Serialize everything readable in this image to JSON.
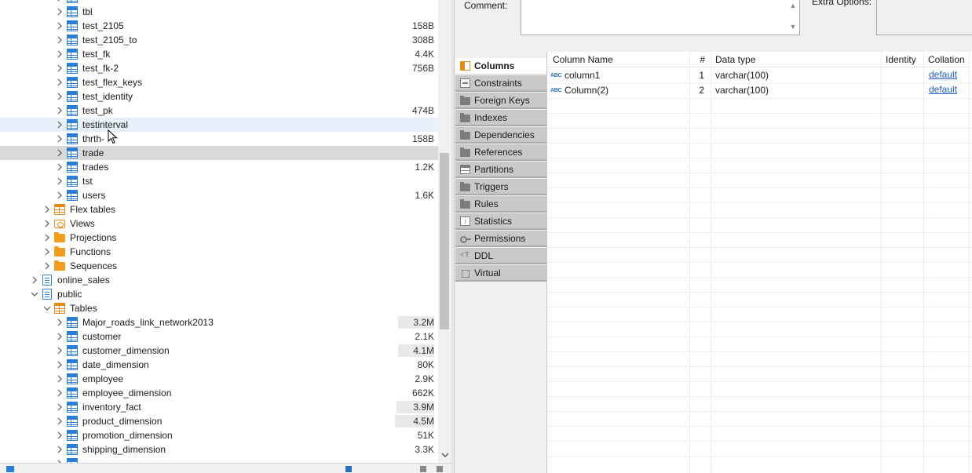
{
  "navigator": {
    "rows": [
      {
        "label": "tbl",
        "size": "",
        "bar": false
      },
      {
        "label": "test_2105",
        "size": "158B",
        "bar": false
      },
      {
        "label": "test_2105_to",
        "size": "308B",
        "bar": false
      },
      {
        "label": "test_fk",
        "size": "4.4K",
        "bar": false
      },
      {
        "label": "test_fk-2",
        "size": "756B",
        "bar": false
      },
      {
        "label": "test_flex_keys",
        "size": "",
        "bar": false
      },
      {
        "label": "test_identity",
        "size": "",
        "bar": false
      },
      {
        "label": "test_pk",
        "size": "474B",
        "bar": false
      },
      {
        "label": "testinterval",
        "size": "",
        "bar": false
      },
      {
        "label": "thrth-",
        "size": "158B",
        "bar": false
      },
      {
        "label": "trade",
        "size": "",
        "bar": false
      },
      {
        "label": "trades",
        "size": "1.2K",
        "bar": false
      },
      {
        "label": "tst",
        "size": "",
        "bar": false
      },
      {
        "label": "users",
        "size": "1.6K",
        "bar": false
      }
    ],
    "folders": {
      "flex_tables": "Flex tables",
      "views": "Views",
      "projections": "Projections",
      "functions": "Functions",
      "sequences": "Sequences"
    },
    "schemas": {
      "online_sales": "online_sales",
      "public": "public"
    },
    "public_tables_folder": "Tables",
    "public_rows": [
      {
        "label": "Major_roads_link_network2013",
        "size": "3.2M",
        "bar": true
      },
      {
        "label": "customer",
        "size": "2.1K",
        "bar": false
      },
      {
        "label": "customer_dimension",
        "size": "4.1M",
        "bar": true
      },
      {
        "label": "date_dimension",
        "size": "80K",
        "bar": false
      },
      {
        "label": "employee",
        "size": "2.9K",
        "bar": false
      },
      {
        "label": "employee_dimension",
        "size": "662K",
        "bar": false
      },
      {
        "label": "inventory_fact",
        "size": "3.9M",
        "bar": true
      },
      {
        "label": "product_dimension",
        "size": "4.5M",
        "bar": true
      },
      {
        "label": "promotion_dimension",
        "size": "51K",
        "bar": false
      },
      {
        "label": "shipping_dimension",
        "size": "3.3K",
        "bar": false
      }
    ]
  },
  "properties": {
    "comment_label": "Comment:",
    "extra_options_label": "Extra Options:"
  },
  "tabs": [
    {
      "label": "Columns",
      "icon": "columns-icon",
      "active": true
    },
    {
      "label": "Constraints",
      "icon": "constraints-icon",
      "active": false
    },
    {
      "label": "Foreign Keys",
      "icon": "folder-icon",
      "active": false
    },
    {
      "label": "Indexes",
      "icon": "folder-icon",
      "active": false
    },
    {
      "label": "Dependencies",
      "icon": "folder-icon",
      "active": false
    },
    {
      "label": "References",
      "icon": "folder-icon",
      "active": false
    },
    {
      "label": "Partitions",
      "icon": "partitions-icon",
      "active": false
    },
    {
      "label": "Triggers",
      "icon": "folder-icon",
      "active": false
    },
    {
      "label": "Rules",
      "icon": "folder-icon",
      "active": false
    },
    {
      "label": "Statistics",
      "icon": "info-icon",
      "active": false
    },
    {
      "label": "Permissions",
      "icon": "key-icon",
      "active": false
    },
    {
      "label": "DDL",
      "icon": "ddl-icon",
      "active": false
    },
    {
      "label": "Virtual",
      "icon": "virtual-icon",
      "active": false
    }
  ],
  "columns_grid": {
    "headers": {
      "name": "Column Name",
      "num": "#",
      "type": "Data type",
      "identity": "Identity",
      "collation": "Collation"
    },
    "type_badge": "ABC",
    "rows": [
      {
        "name": "column1",
        "num": "1",
        "type": "varchar(100)",
        "identity": "",
        "collation": "default"
      },
      {
        "name": "Column(2)",
        "num": "2",
        "type": "varchar(100)",
        "identity": "",
        "collation": "default"
      }
    ]
  }
}
